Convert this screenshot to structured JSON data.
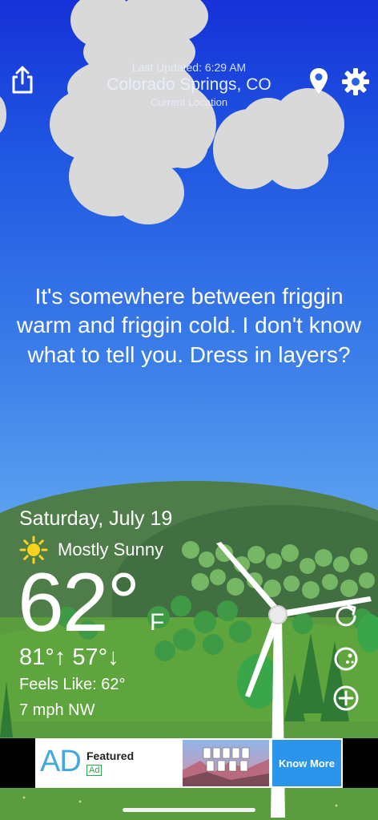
{
  "header": {
    "last_updated": "Last Updated: 6:29 AM",
    "city": "Colorado Springs, CO",
    "location_label": "Current Location"
  },
  "icons": {
    "share": "share-icon",
    "location": "location-pin-icon",
    "settings": "gear-icon",
    "refresh": "refresh-icon",
    "moon": "moon-phase-icon",
    "add": "plus-circle-icon",
    "condition": "sun-icon"
  },
  "message": "It's somewhere between friggin warm and friggin cold. I don't know what to tell you. Dress in layers?",
  "weather": {
    "date": "Saturday, July 19",
    "condition": "Mostly Sunny",
    "temperature": "62°",
    "unit": "F",
    "hi_lo": "81°↑ 57°↓",
    "feels_like": "Feels Like: 62°",
    "wind": "7 mph NW"
  },
  "ad": {
    "logo": "AD",
    "title": "Featured",
    "badge": "Ad",
    "cta": "Know More"
  },
  "colors": {
    "sky_top": "#1631d8",
    "sky_bottom": "#74b4f3",
    "grass": "#5a9c3e",
    "ad_cta": "#2b95ec"
  }
}
